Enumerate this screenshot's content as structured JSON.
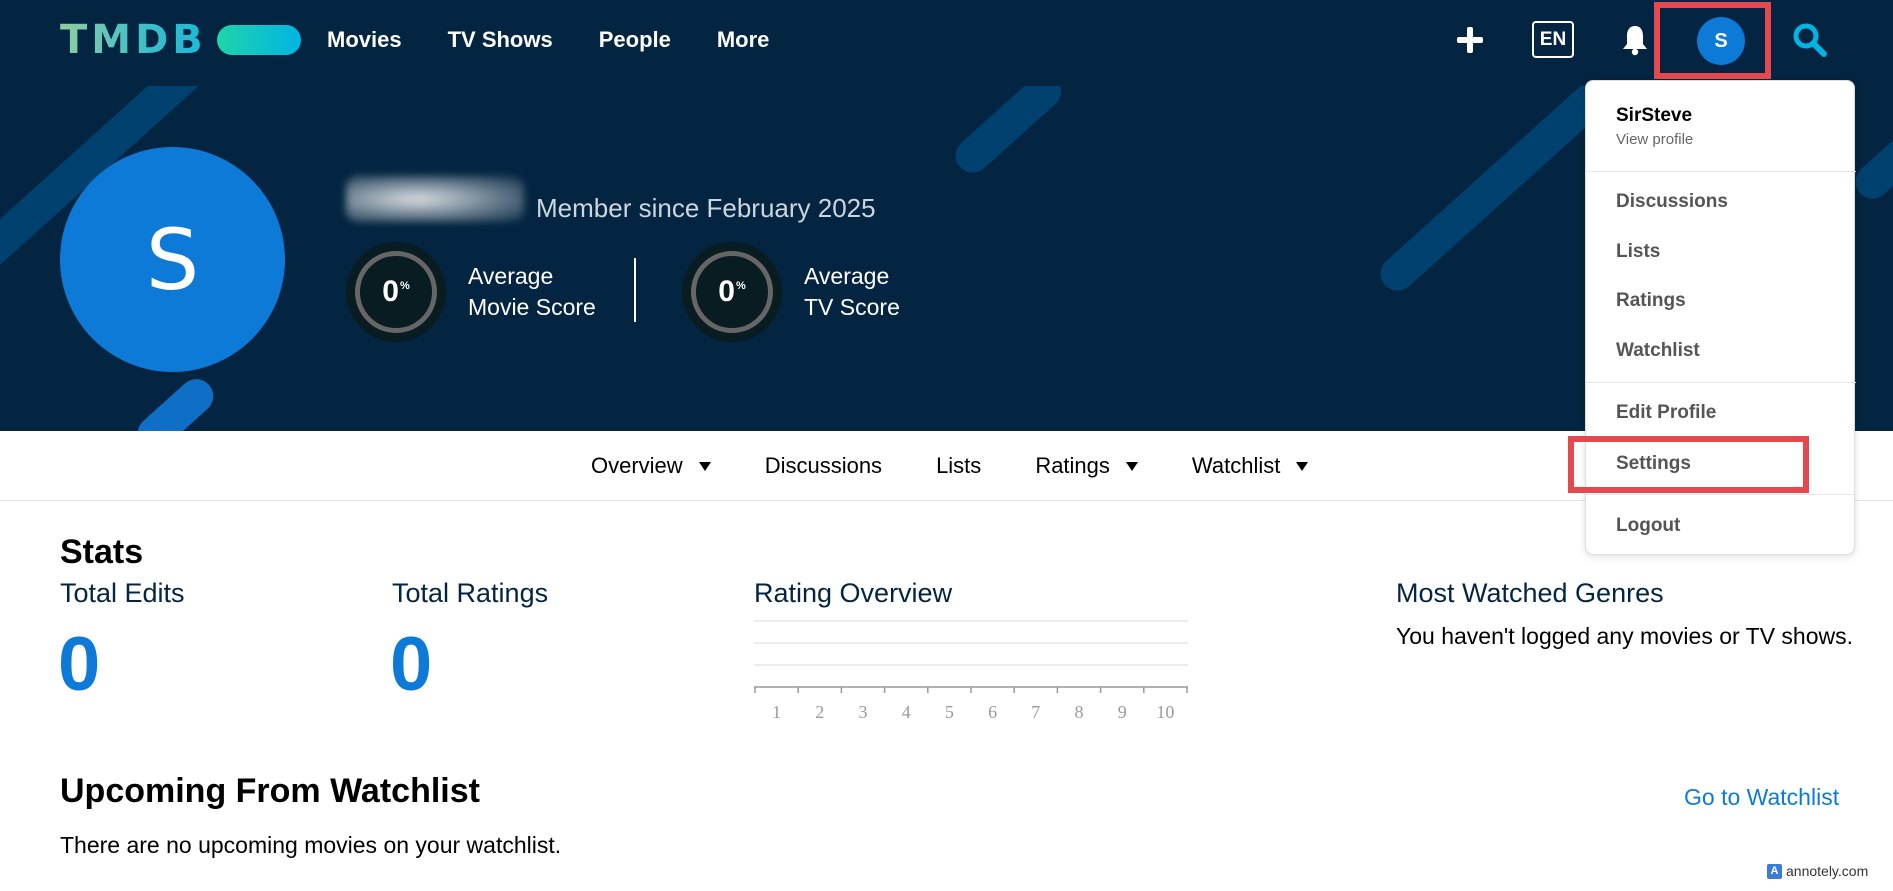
{
  "header": {
    "logo_text": "TMDB",
    "nav": [
      "Movies",
      "TV Shows",
      "People",
      "More"
    ],
    "language": "EN",
    "avatar_initial": "S"
  },
  "profile": {
    "avatar_initial": "S",
    "member_since": "Member since February 2025",
    "movie_score": {
      "value": "0",
      "unit": "%",
      "label_line1": "Average",
      "label_line2": "Movie Score"
    },
    "tv_score": {
      "value": "0",
      "unit": "%",
      "label_line1": "Average",
      "label_line2": "TV Score"
    }
  },
  "subnav": [
    "Overview",
    "Discussions",
    "Lists",
    "Ratings",
    "Watchlist"
  ],
  "stats": {
    "title": "Stats",
    "total_edits_label": "Total Edits",
    "total_edits_value": "0",
    "total_ratings_label": "Total Ratings",
    "total_ratings_value": "0",
    "rating_overview_label": "Rating Overview",
    "rating_ticks": [
      "1",
      "2",
      "3",
      "4",
      "5",
      "6",
      "7",
      "8",
      "9",
      "10"
    ],
    "genres_label": "Most Watched Genres",
    "genres_empty": "You haven't logged any movies or TV shows."
  },
  "upcoming": {
    "title": "Upcoming From Watchlist",
    "link": "Go to Watchlist",
    "empty": "There are no upcoming movies on your watchlist."
  },
  "dropdown": {
    "username": "SirSteve",
    "view_profile": "View profile",
    "items": [
      "Discussions",
      "Lists",
      "Ratings",
      "Watchlist",
      "Edit Profile",
      "Settings",
      "Logout"
    ]
  },
  "colors": {
    "navy": "#032541",
    "accent_blue": "#0d7ad7",
    "highlight_red": "#e5484d"
  },
  "watermark": "annotely.com"
}
